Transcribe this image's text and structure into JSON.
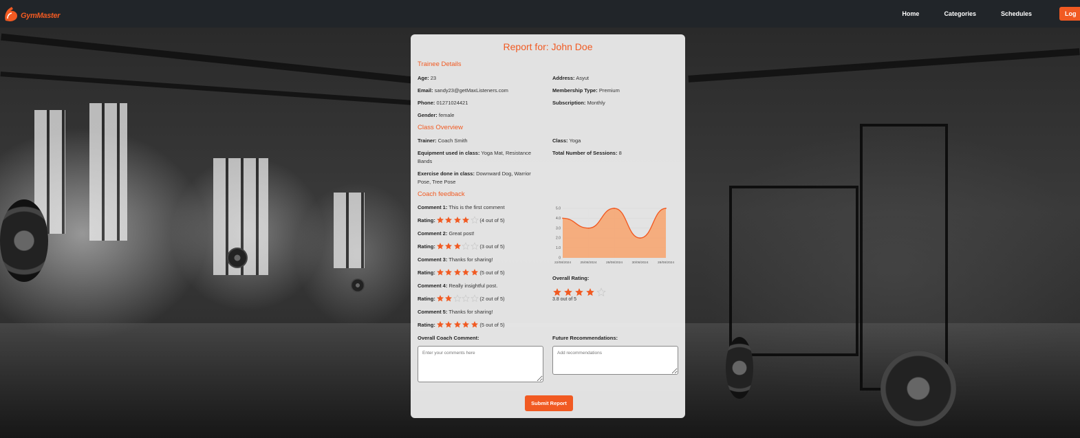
{
  "app": {
    "name": "GymMaster"
  },
  "nav": {
    "links": [
      "Home",
      "Categories",
      "Schedules"
    ],
    "login_label": "Log"
  },
  "report": {
    "title": "Report for: John Doe",
    "trainee_section": "Trainee Details",
    "trainee": {
      "age": {
        "label": "Age:",
        "value": "23"
      },
      "email": {
        "label": "Email:",
        "value": "sandy23@getMaxListeners.com"
      },
      "phone": {
        "label": "Phone:",
        "value": "01271024421"
      },
      "gender": {
        "label": "Gender:",
        "value": "female"
      },
      "address": {
        "label": "Address:",
        "value": "Asyut"
      },
      "membership": {
        "label": "Membership Type:",
        "value": "Premium"
      },
      "subscription": {
        "label": "Subscription:",
        "value": "Monthly"
      }
    },
    "class_section": "Class Overview",
    "class_info": {
      "trainer": {
        "label": "Trainer:",
        "value": "Coach Smith"
      },
      "equipment": {
        "label": "Equipment used in class:",
        "value": "Yoga Mat, Resistance Bands"
      },
      "exercise": {
        "label": "Exercise done in class:",
        "value": "Downward Dog, Warrior Pose, Tree Pose"
      },
      "class": {
        "label": "Class:",
        "value": "Yoga"
      },
      "sessions": {
        "label": "Total Number of Sessions:",
        "value": "8"
      }
    },
    "feedback_section": "Coach feedback",
    "rating_label": "Rating:",
    "comments": [
      {
        "label": "Comment 1:",
        "text": "This is the first comment",
        "stars": 4,
        "rating_text": "(4 out of 5)"
      },
      {
        "label": "Comment 2:",
        "text": "Great post!",
        "stars": 3,
        "rating_text": "(3 out of 5)"
      },
      {
        "label": "Comment 3:",
        "text": "Thanks for sharing!",
        "stars": 5,
        "rating_text": "(5 out of 5)"
      },
      {
        "label": "Comment 4:",
        "text": "Really insightful post.",
        "stars": 2,
        "rating_text": "(2 out of 5)"
      },
      {
        "label": "Comment 5:",
        "text": "Thanks for sharing!",
        "stars": 5,
        "rating_text": "(5 out of 5)"
      }
    ],
    "overall_rating_label": "Overall Rating:",
    "overall_rating_stars": 4,
    "overall_rating_text": "3.8 out of 5",
    "overall_comment_label": "Overall Coach Comment:",
    "overall_comment_placeholder": "Enter your comments here",
    "future_label": "Future Recommendations:",
    "future_placeholder": "Add recommendations",
    "submit_label": "Submit Report"
  },
  "colors": {
    "accent": "#f15a22",
    "star_empty": "#c8c8c8",
    "chart_fill": "#f6a672"
  },
  "chart_data": {
    "type": "area",
    "categories": [
      "22/08/2024",
      "25/08/2024",
      "28/08/2024",
      "30/08/2024",
      "28/08/2024"
    ],
    "values": [
      4.0,
      3.0,
      5.0,
      2.0,
      5.0
    ],
    "ylim": [
      0,
      5
    ],
    "yticks": [
      "5.0",
      "4.0",
      "3.0",
      "2.0",
      "1.0",
      "0"
    ],
    "grid": true,
    "title": "",
    "xlabel": "",
    "ylabel": ""
  }
}
